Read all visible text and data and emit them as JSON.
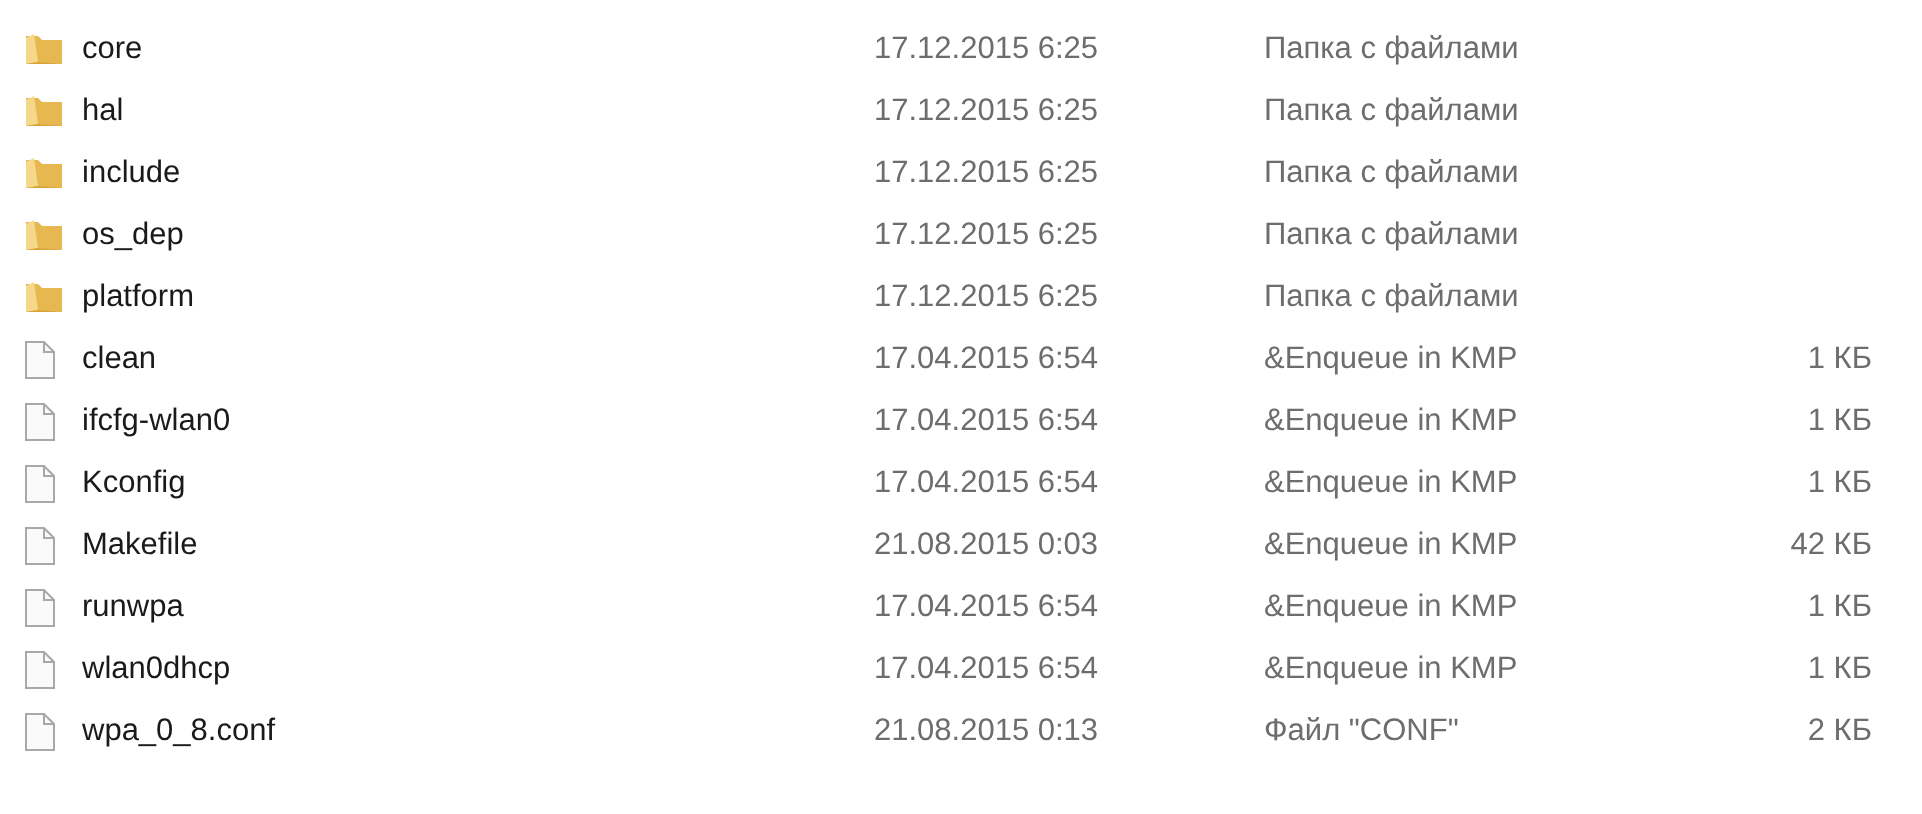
{
  "files": [
    {
      "kind": "folder",
      "name": "core",
      "date": "17.12.2015 6:25",
      "type": "Папка с файлами"
    },
    {
      "kind": "folder",
      "name": "hal",
      "date": "17.12.2015 6:25",
      "type": "Папка с файлами"
    },
    {
      "kind": "folder",
      "name": "include",
      "date": "17.12.2015 6:25",
      "type": "Папка с файлами"
    },
    {
      "kind": "folder",
      "name": "os_dep",
      "date": "17.12.2015 6:25",
      "type": "Папка с файлами"
    },
    {
      "kind": "folder",
      "name": "platform",
      "date": "17.12.2015 6:25",
      "type": "Папка с файлами"
    },
    {
      "kind": "file",
      "name": "clean",
      "date": "17.04.2015 6:54",
      "type": "&Enqueue in KMP",
      "size": "1 КБ"
    },
    {
      "kind": "file",
      "name": "ifcfg-wlan0",
      "date": "17.04.2015 6:54",
      "type": "&Enqueue in KMP",
      "size": "1 КБ"
    },
    {
      "kind": "file",
      "name": "Kconfig",
      "date": "17.04.2015 6:54",
      "type": "&Enqueue in KMP",
      "size": "1 КБ"
    },
    {
      "kind": "file",
      "name": "Makefile",
      "date": "21.08.2015 0:03",
      "type": "&Enqueue in KMP",
      "size": "42 КБ"
    },
    {
      "kind": "file",
      "name": "runwpa",
      "date": "17.04.2015 6:54",
      "type": "&Enqueue in KMP",
      "size": "1 КБ"
    },
    {
      "kind": "file",
      "name": "wlan0dhcp",
      "date": "17.04.2015 6:54",
      "type": "&Enqueue in KMP",
      "size": "1 КБ"
    },
    {
      "kind": "file",
      "name": "wpa_0_8.conf",
      "date": "21.08.2015 0:13",
      "type": "Файл \"CONF\"",
      "size": "2 КБ"
    }
  ]
}
